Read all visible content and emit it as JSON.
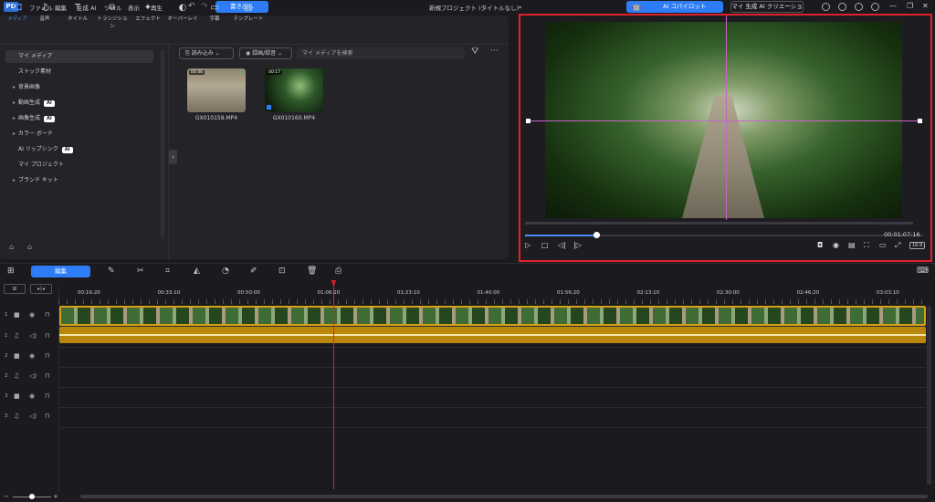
{
  "app": {
    "logo_text": "PD",
    "title": "新規プロジェクト (タイトルなし)*"
  },
  "menu": [
    "ファイル",
    "編集",
    "生成 AI",
    "ツール",
    "表示",
    "再生"
  ],
  "buttons": {
    "export": "書き出し",
    "ai_copilot": "AI コパイロット",
    "ai_creation": "マイ 生成 AI クリエーション",
    "edit": "編集"
  },
  "tabs": [
    {
      "label": "メディア",
      "icon": "🎞"
    },
    {
      "label": "音声",
      "icon": "♫"
    },
    {
      "label": "タイトル",
      "icon": "T"
    },
    {
      "label": "トランジション",
      "icon": "⧉"
    },
    {
      "label": "エフェクト",
      "icon": "✦"
    },
    {
      "label": "オーバーレイ",
      "icon": "◐"
    },
    {
      "label": "字幕",
      "icon": "▭"
    },
    {
      "label": "テンプレート",
      "icon": "▤"
    }
  ],
  "sidebar": [
    {
      "label": "マイ メディア",
      "arrow": "",
      "ai": false
    },
    {
      "label": "ストック素材",
      "arrow": "",
      "ai": false
    },
    {
      "label": "背景画像",
      "arrow": "▸",
      "ai": false
    },
    {
      "label": "動画生成",
      "arrow": "▸",
      "ai": true
    },
    {
      "label": "画像生成",
      "arrow": "▸",
      "ai": true
    },
    {
      "label": "カラー ボード",
      "arrow": "▸",
      "ai": false
    },
    {
      "label": "AI リップシンク",
      "arrow": "",
      "ai": true
    },
    {
      "label": "マイ プロジェクト",
      "arrow": "",
      "ai": false
    },
    {
      "label": "ブランド キット",
      "arrow": "▸",
      "ai": false
    }
  ],
  "ai_badge": "AI",
  "media_toolbar": {
    "import": "読み込み",
    "record": "録画/録音",
    "search_placeholder": "マイ メディアを検索"
  },
  "media_items": [
    {
      "name": "GX010158.MP4",
      "duration": "00:46"
    },
    {
      "name": "GX010160.MP4",
      "duration": "00:17"
    }
  ],
  "preview": {
    "timecode": "00:01:07:16",
    "aspect": "16:9",
    "progress": 0.18
  },
  "ruler": [
    "00:16:20",
    "00:33:10",
    "00:50:00",
    "01:06:20",
    "01:23:10",
    "01:40:00",
    "01:56:20",
    "02:13:10",
    "02:30:00",
    "02:46:20",
    "03:03:10"
  ],
  "tracks": [
    {
      "num": "1",
      "type": "video"
    },
    {
      "num": "1",
      "type": "audio"
    },
    {
      "num": "2",
      "type": "video"
    },
    {
      "num": "2",
      "type": "audio"
    },
    {
      "num": "3",
      "type": "video"
    },
    {
      "num": "3",
      "type": "audio"
    }
  ]
}
